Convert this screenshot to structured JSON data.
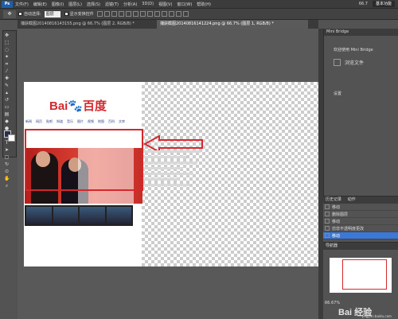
{
  "menubar": {
    "logo": "Ps",
    "items": [
      "文件(F)",
      "编辑(E)",
      "图像(I)",
      "图层(L)",
      "选择(S)",
      "滤镜(T)",
      "分析(A)",
      "3D(D)",
      "视图(V)",
      "窗口(W)",
      "帮助(H)"
    ],
    "zoom": "66.7",
    "workspace": "基本功能"
  },
  "optbar": {
    "auto_select_label": "自动选择:",
    "auto_select_value": "图层",
    "show_transform_label": "显示变换控件"
  },
  "tabs": [
    {
      "label": "捕获截图20140816143155.png @ 66.7% (图层 2, RGB/8) *",
      "active": false
    },
    {
      "label": "捕获截图20140816141224.png @ 66.7% (图层 1, RGB/8) *",
      "active": true
    }
  ],
  "document": {
    "logo_text_left": "Bai",
    "logo_text_mid": "百度",
    "nav_items": [
      "新闻",
      "网页",
      "贴吧",
      "知道",
      "音乐",
      "图片",
      "视频",
      "地图",
      "百科",
      "文库"
    ]
  },
  "panels": {
    "bridge_title": "Mini Bridge",
    "welcome": "欢迎使用 Mini Bridge",
    "browse_label": "浏览文件",
    "settings_label": "设置",
    "history_tabs": [
      "历史记录",
      "动作"
    ],
    "history_items": [
      {
        "label": "移动",
        "selected": false
      },
      {
        "label": "删除图层",
        "selected": false
      },
      {
        "label": "移动",
        "selected": false
      },
      {
        "label": "仿非不透明度更改",
        "selected": false
      },
      {
        "label": "移动",
        "selected": true
      }
    ],
    "navigator_title": "导航器",
    "navigator_zoom": "66.67%"
  },
  "watermark": {
    "text": "Bai 经验",
    "sub": "jingyan.baidu.com"
  }
}
